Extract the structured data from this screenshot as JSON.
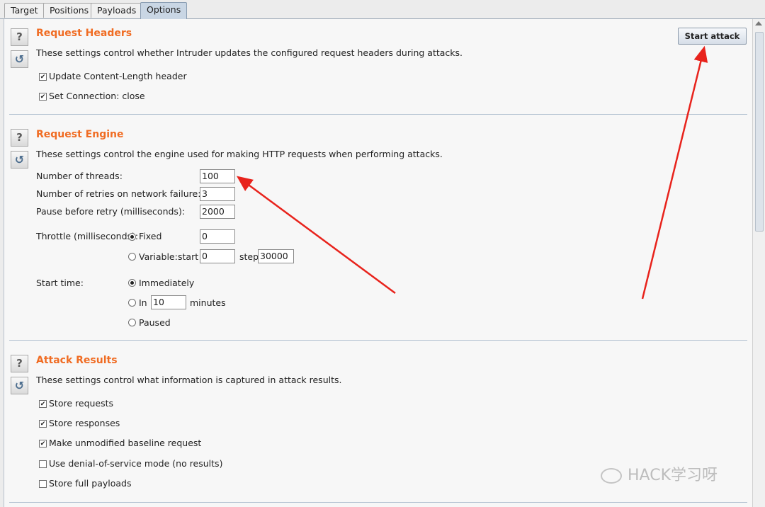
{
  "tabs": [
    "Target",
    "Positions",
    "Payloads",
    "Options"
  ],
  "active_tab": "Options",
  "toolbar": {
    "start_attack": "Start attack"
  },
  "request_headers": {
    "title": "Request Headers",
    "description": "These settings control whether Intruder updates the configured request headers during attacks.",
    "options": [
      {
        "label": "Update Content-Length header",
        "checked": true
      },
      {
        "label": "Set Connection: close",
        "checked": true
      }
    ]
  },
  "request_engine": {
    "title": "Request Engine",
    "description": "These settings control the engine used for making HTTP requests when performing attacks.",
    "threads_label": "Number of threads:",
    "threads_value": "100",
    "retries_label": "Number of retries on network failure:",
    "retries_value": "3",
    "pause_label": "Pause before retry (milliseconds):",
    "pause_value": "2000",
    "throttle_label": "Throttle (milliseconds):",
    "throttle_fixed_label": "Fixed",
    "throttle_fixed_value": "0",
    "throttle_variable_label": "Variable:",
    "throttle_start_label": "start",
    "throttle_start_value": "0",
    "throttle_step_label": "step",
    "throttle_step_value": "30000",
    "start_time_label": "Start time:",
    "start_immediately": "Immediately",
    "start_in": "In",
    "start_in_value": "10",
    "start_in_unit": "minutes",
    "start_paused": "Paused"
  },
  "attack_results": {
    "title": "Attack Results",
    "description": "These settings control what information is captured in attack results.",
    "options": [
      {
        "label": "Store requests",
        "checked": true
      },
      {
        "label": "Store responses",
        "checked": true
      },
      {
        "label": "Make unmodified baseline request",
        "checked": true
      },
      {
        "label": "Use denial-of-service mode (no results)",
        "checked": false
      },
      {
        "label": "Store full payloads",
        "checked": false
      }
    ]
  },
  "watermark": "HACK学习呀",
  "colors": {
    "section_title": "#f06c23",
    "annotation_arrow": "#e8231c"
  }
}
